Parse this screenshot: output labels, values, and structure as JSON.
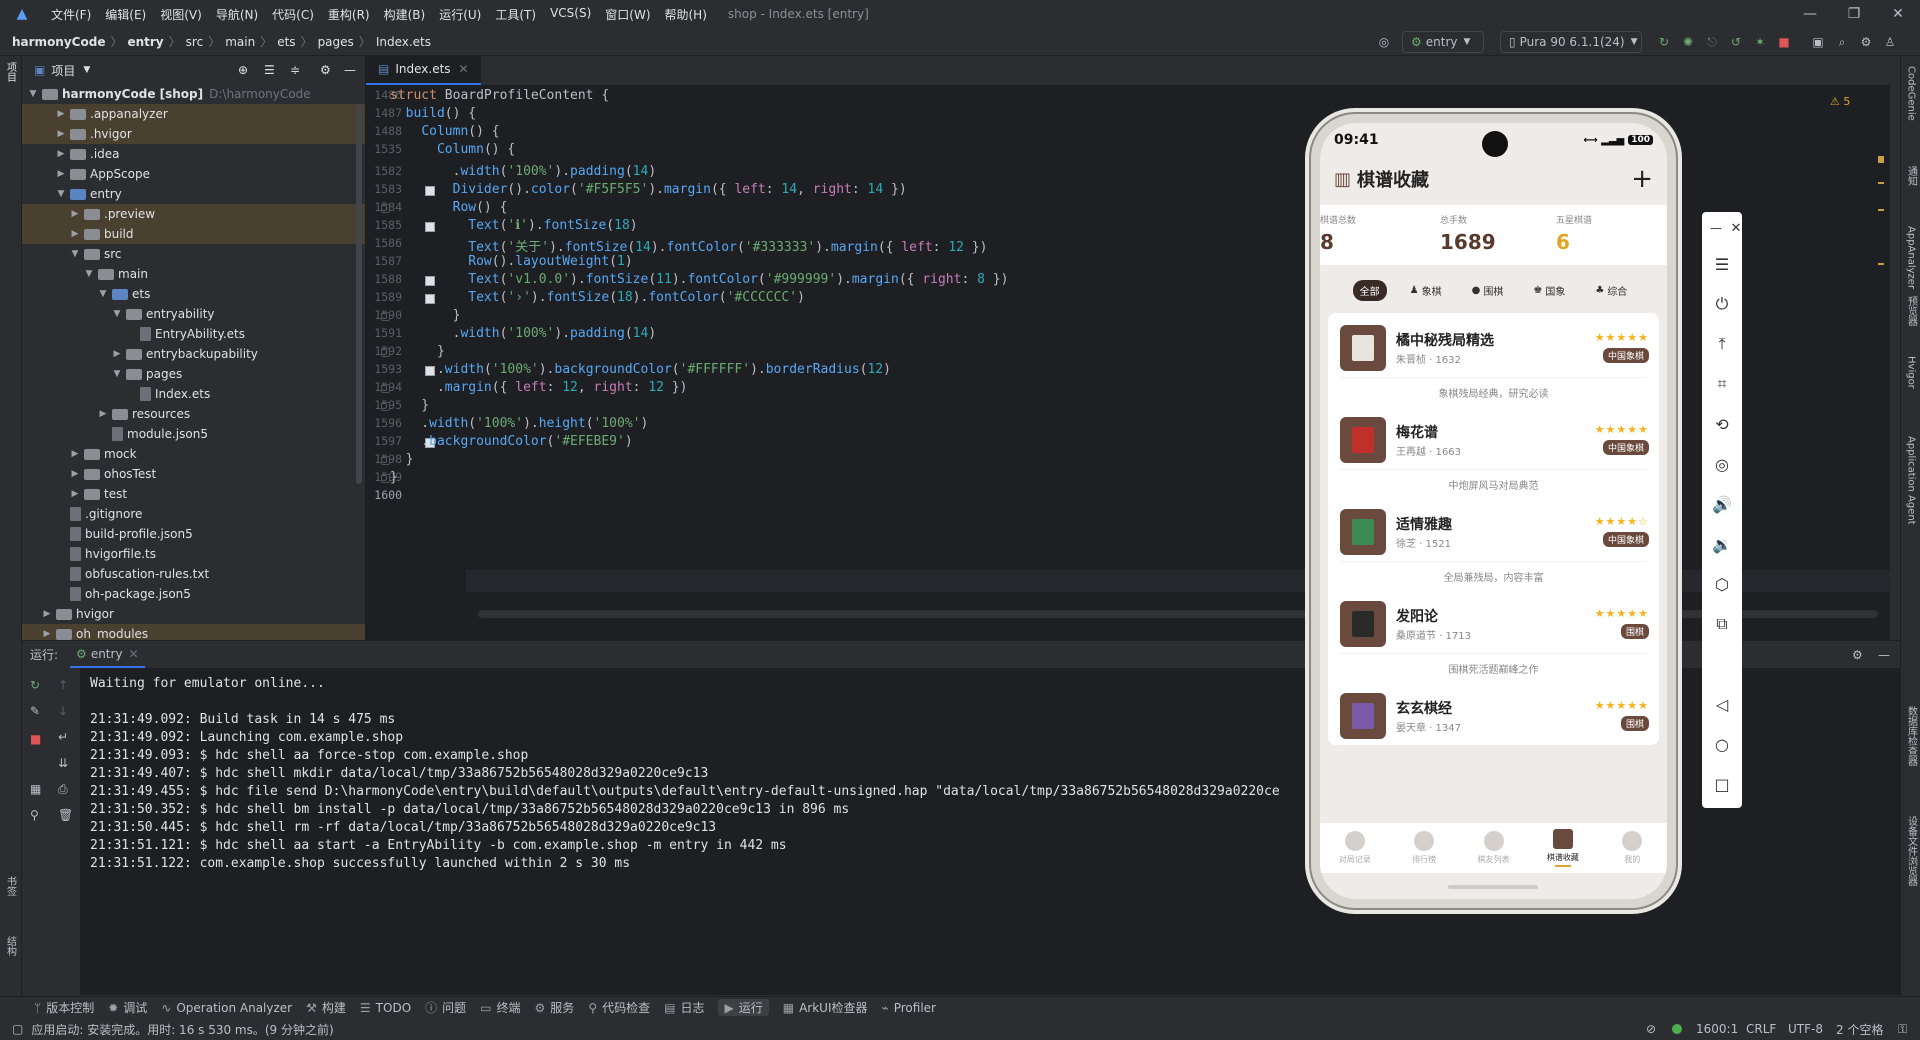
{
  "menu": {
    "items": [
      "文件(F)",
      "编辑(E)",
      "视图(V)",
      "导航(N)",
      "代码(C)",
      "重构(R)",
      "构建(B)",
      "运行(U)",
      "工具(T)",
      "VCS(S)",
      "窗口(W)",
      "帮助(H)"
    ],
    "title": "shop - Index.ets [entry]"
  },
  "breadcrumb": [
    "harmonyCode",
    "entry",
    "src",
    "main",
    "ets",
    "pages",
    "Index.ets"
  ],
  "toolbar": {
    "config": "entry",
    "device": "Pura 90 6.1.1(24)"
  },
  "project": {
    "header": "项目",
    "root_name": "harmonyCode [shop]",
    "root_path": "D:\\harmonyCode",
    "items": [
      ".appanalyzer",
      ".hvigor",
      ".idea",
      "AppScope",
      "entry",
      ".preview",
      "build",
      "src",
      "main",
      "ets",
      "entryability",
      "EntryAbility.ets",
      "entrybackupability",
      "pages",
      "Index.ets",
      "resources",
      "module.json5",
      "mock",
      "ohosTest",
      "test",
      ".gitignore",
      "build-profile.json5",
      "hvigorfile.ts",
      "obfuscation-rules.txt",
      "oh-package.json5",
      "hvigor",
      "oh_modules"
    ]
  },
  "editor": {
    "tab": "Index.ets",
    "warnings": "5",
    "line_numbers": [
      "1486",
      "1487",
      "1488",
      "1535",
      "1582",
      "1583",
      "1584",
      "1585",
      "1586",
      "1587",
      "1588",
      "1589",
      "1590",
      "1591",
      "1592",
      "1593",
      "1594",
      "1595",
      "1596",
      "1597",
      "1598",
      "1599",
      "1600"
    ]
  },
  "run": {
    "label": "运行:",
    "tab": "entry",
    "lines": [
      "Waiting for emulator online...",
      "",
      "21:31:49.092: Build task in 14 s 475 ms",
      "21:31:49.092: Launching com.example.shop",
      "21:31:49.093: $ hdc shell aa force-stop com.example.shop",
      "21:31:49.407: $ hdc shell mkdir data/local/tmp/33a86752b56548028d329a0220ce9c13",
      "21:31:49.455: $ hdc file send D:\\harmonyCode\\entry\\build\\default\\outputs\\default\\entry-default-unsigned.hap \"data/local/tmp/33a86752b56548028d329a0220ce",
      "21:31:50.352: $ hdc shell bm install -p data/local/tmp/33a86752b56548028d329a0220ce9c13 in 896 ms",
      "21:31:50.445: $ hdc shell rm -rf data/local/tmp/33a86752b56548028d329a0220ce9c13",
      "21:31:51.121: $ hdc shell aa start -a EntryAbility -b com.example.shop -m entry in 442 ms",
      "21:31:51.122: com.example.shop successfully launched within 2 s 30 ms"
    ]
  },
  "bottom_tools": [
    "版本控制",
    "调试",
    "Operation Analyzer",
    "构建",
    "TODO",
    "问题",
    "终端",
    "服务",
    "代码检查",
    "日志",
    "运行",
    "ArkUI检查器",
    "Profiler"
  ],
  "status": {
    "message": "应用启动: 安装完成。用时: 16 s 530 ms。(9 分钟之前)",
    "position": "1600:1",
    "line_sep": "CRLF",
    "encoding": "UTF-8",
    "indent": "2 个空格"
  },
  "right_strip": [
    "CodeGenie",
    "通知",
    "AppAnalyzer",
    "预览器",
    "Hvigor",
    "Application Agent",
    "数据库检查器",
    "设备文件浏览器"
  ],
  "left_strip": [
    "项目",
    "书签",
    "结构"
  ],
  "phone": {
    "time": "09:41",
    "battery": "100",
    "app_title": "棋谱收藏",
    "stats": [
      {
        "label": "棋谱总数",
        "value": "8",
        "color": "#5b3a2e"
      },
      {
        "label": "总手数",
        "value": "1689",
        "color": "#5b3a2e"
      },
      {
        "label": "五星棋谱",
        "value": "6",
        "color": "#e0a526"
      }
    ],
    "filters": [
      "全部",
      "象棋",
      "围棋",
      "国象",
      "综合"
    ],
    "books": [
      {
        "title": "橘中秘残局精选",
        "sub": "朱晋桢 · 1632",
        "stars": "★★★★★",
        "badge": "中国象棋",
        "desc": "象棋残局经典，研究必读",
        "cover": "#e8e4de"
      },
      {
        "title": "梅花谱",
        "sub": "王再越 · 1663",
        "stars": "★★★★★",
        "badge": "中国象棋",
        "desc": "中炮屏风马对局典范",
        "cover": "#c0302a"
      },
      {
        "title": "适情雅趣",
        "sub": "徐芝 · 1521",
        "stars": "★★★★☆",
        "badge": "中国象棋",
        "desc": "全局兼残局，内容丰富",
        "cover": "#3d8a55"
      },
      {
        "title": "发阳论",
        "sub": "桑原道节 · 1713",
        "stars": "★★★★★",
        "badge": "围棋",
        "desc": "围棋死活题巅峰之作",
        "cover": "#2a2a2a"
      },
      {
        "title": "玄玄棋经",
        "sub": "晏天章 · 1347",
        "stars": "★★★★★",
        "badge": "围棋",
        "desc": "",
        "cover": "#7a5aa6"
      }
    ],
    "tabs": [
      "对局记录",
      "排行榜",
      "棋友列表",
      "棋谱收藏",
      "我的"
    ]
  }
}
